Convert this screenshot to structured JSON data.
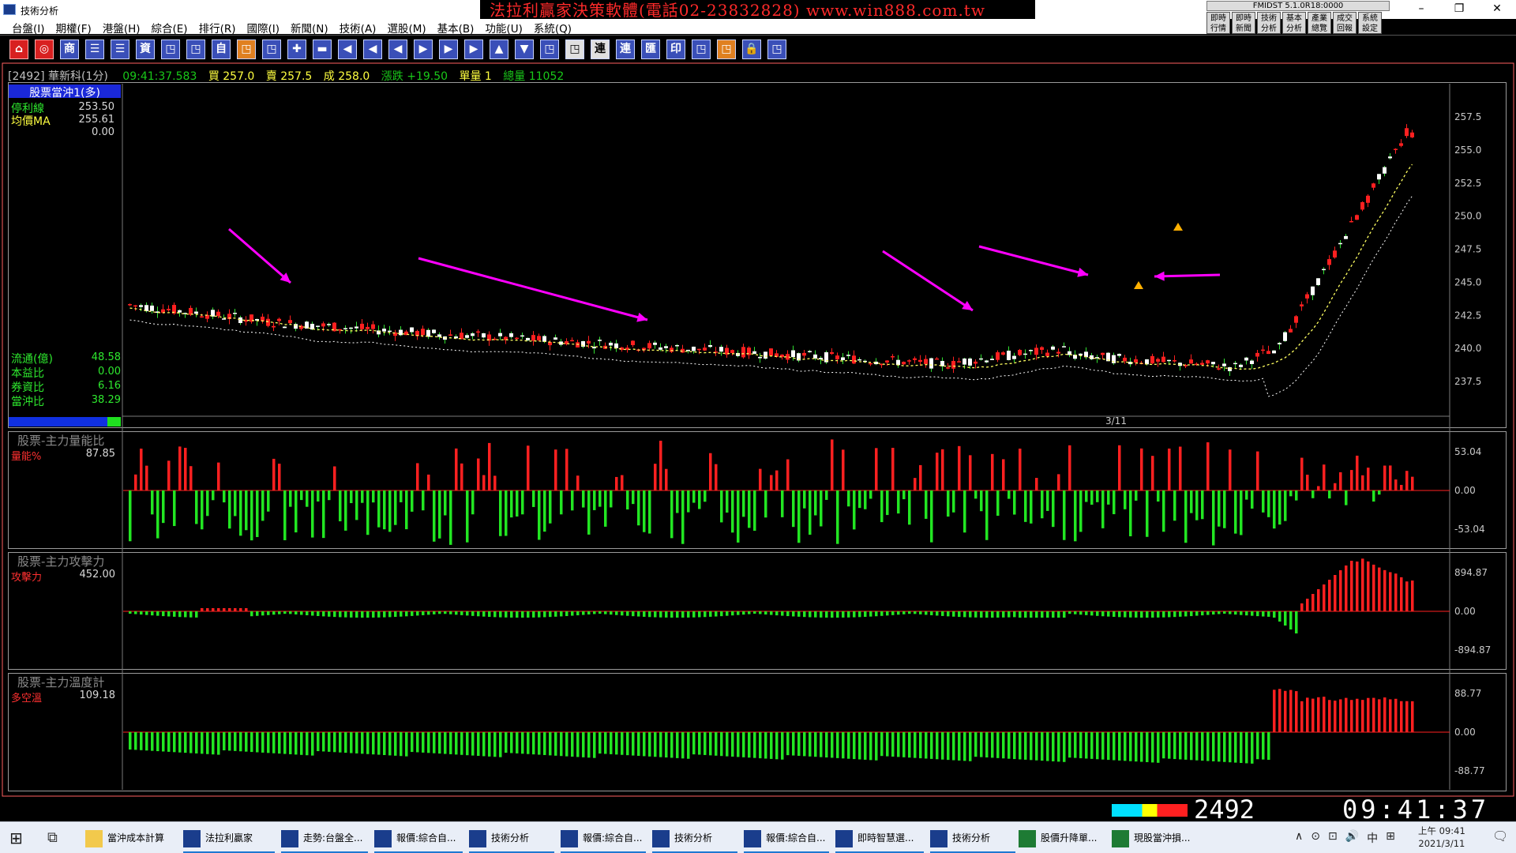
{
  "window": {
    "title": "技術分析",
    "minimize": "–",
    "restore": "❐",
    "close": "✕"
  },
  "banner": "法拉利贏家決策軟體(電話02-23832828) www.win888.com.tw",
  "fmidst": "FMIDST 5.1.0R18:0000",
  "quick_buttons": [
    "即時行情",
    "即時新聞",
    "技術分析",
    "基本分析",
    "產業總覽",
    "成交回報",
    "系統設定"
  ],
  "menu": [
    "台盤(I)",
    "期權(F)",
    "港盤(H)",
    "綜合(E)",
    "排行(R)",
    "國際(I)",
    "新聞(N)",
    "技術(A)",
    "選股(M)",
    "基本(B)",
    "功能(U)",
    "系統(Q)"
  ],
  "toolbar_glyphs": [
    "⌂",
    "◎",
    "商",
    "☰",
    "☰",
    "資",
    "◳",
    "◳",
    "自",
    "◳",
    "◳",
    "✚",
    "▬",
    "◀",
    "◀",
    "◀",
    "▶",
    "▶",
    "▶",
    "▲",
    "▼",
    "◳",
    "◳",
    "連",
    "連",
    "匯",
    "印",
    "◳",
    "◳",
    "🔒",
    "◳"
  ],
  "infobar": {
    "code": "[2492] 華新科(1分)",
    "time": "09:41:37.583",
    "bid": "買 257.0",
    "ask": "賣 257.5",
    "deal": "成 258.0",
    "chg": "漲跌 +19.50",
    "vol": "單量 1",
    "total": "總量 11052"
  },
  "main_panel": {
    "header": "股票當沖1(多)",
    "lines": [
      {
        "label": "停利線",
        "value": "253.50"
      },
      {
        "label": "均價MA",
        "value": "255.61"
      },
      {
        "label": "",
        "value": "0.00"
      }
    ],
    "stats": [
      {
        "label": "流通(億)",
        "value": "48.58"
      },
      {
        "label": "本益比",
        "value": "0.00"
      },
      {
        "label": "券資比",
        "value": "6.16"
      },
      {
        "label": "當沖比",
        "value": "38.29"
      }
    ],
    "date_label": "3/11",
    "price_ticks": [
      "257.5",
      "255.0",
      "252.5",
      "250.0",
      "247.5",
      "245.0",
      "242.5",
      "240.0",
      "237.5"
    ]
  },
  "sub1": {
    "title": "股票-主力量能比",
    "ind_label": "量能%",
    "ind_value": "87.85",
    "ticks": [
      "53.04",
      "0.00",
      "-53.04"
    ]
  },
  "sub2": {
    "title": "股票-主力攻擊力",
    "ind_label": "攻擊力",
    "ind_value": "452.00",
    "ticks": [
      "894.87",
      "0.00",
      "-894.87"
    ]
  },
  "sub3": {
    "title": "股票-主力溫度計",
    "ind_label": "多空溫",
    "ind_value": "109.18",
    "ticks": [
      "88.77",
      "0.00",
      "-88.77"
    ]
  },
  "statusbar": {
    "code": "2492",
    "clock": "09:41:37"
  },
  "taskbar": {
    "items": [
      "當沖成本計算",
      "法拉利贏家",
      "走勢:台盤全...",
      "報價:綜合自...",
      "技術分析",
      "報價:綜合自...",
      "技術分析",
      "報價:綜合自...",
      "即時智慧選...",
      "技術分析",
      "股價升降單...",
      "現股當沖損..."
    ],
    "tray": [
      "∧",
      "⊙",
      "⊡",
      "🔊",
      "中",
      "⊞"
    ],
    "clock_time": "上午 09:41",
    "clock_date": "2021/3/11"
  },
  "colors": {
    "up": "#ff2020",
    "down": "#22e622",
    "grid": "#7a7a7a",
    "accent": "#ff00ff",
    "label_red": "#ff3030",
    "label_green": "#2ee82e"
  }
}
